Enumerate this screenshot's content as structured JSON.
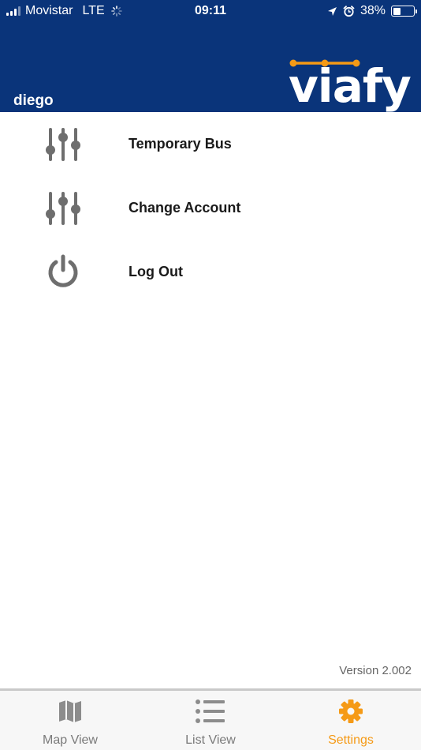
{
  "status_bar": {
    "carrier": "Movistar",
    "network": "LTE",
    "time": "09:11",
    "battery_percent_label": "38%",
    "battery_level": 0.38
  },
  "header": {
    "username": "diego",
    "logo_text": "viafy",
    "background_color": "#0a347a",
    "logo_accent_color": "#f59a16"
  },
  "menu": {
    "items": [
      {
        "label": "Temporary Bus",
        "icon": "sliders-icon"
      },
      {
        "label": "Change Account",
        "icon": "sliders-icon"
      },
      {
        "label": "Log Out",
        "icon": "power-icon"
      }
    ]
  },
  "footer": {
    "version": "Version 2.002"
  },
  "tabbar": {
    "tabs": [
      {
        "label": "Map View",
        "icon": "map-icon",
        "active": false
      },
      {
        "label": "List View",
        "icon": "list-icon",
        "active": false
      },
      {
        "label": "Settings",
        "icon": "gear-icon",
        "active": true
      }
    ],
    "active_color": "#f59a16",
    "inactive_color": "#7a7a7a"
  }
}
